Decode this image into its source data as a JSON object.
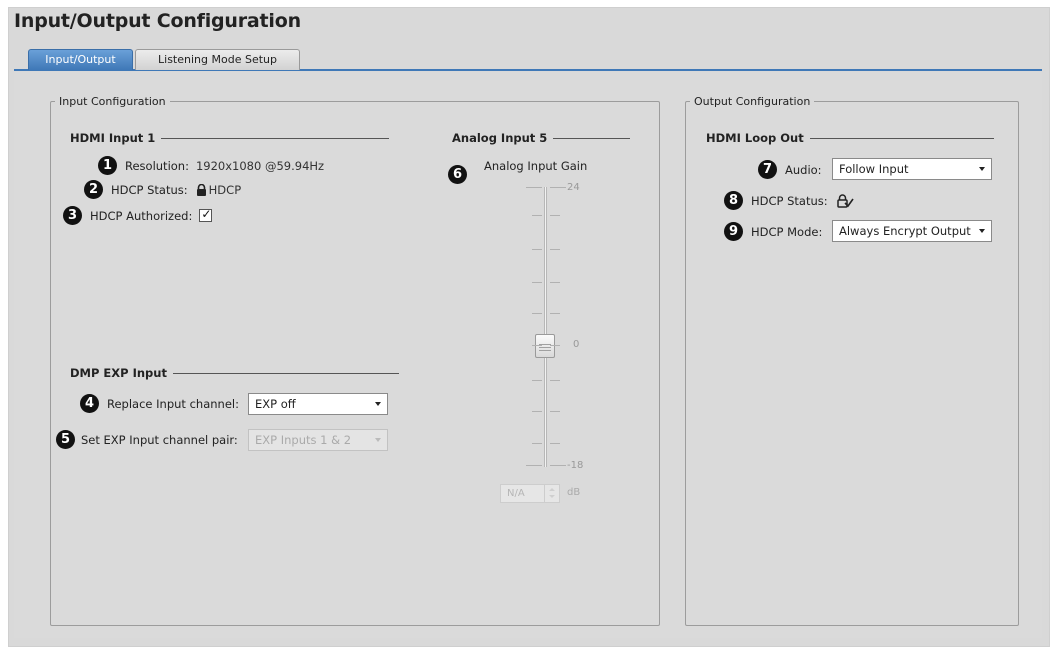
{
  "page": {
    "title": "Input/Output Configuration"
  },
  "tabs": [
    {
      "label": "Input/Output",
      "active": true
    },
    {
      "label": "Listening Mode Setup",
      "active": false
    }
  ],
  "input_config": {
    "legend": "Input Configuration",
    "hdmi_input": {
      "heading": "HDMI Input 1",
      "resolution_label": "Resolution:",
      "resolution_value": "1920x1080 @59.94Hz",
      "hdcp_status_label": "HDCP Status:",
      "hdcp_status_value": "HDCP",
      "hdcp_authorized_label": "HDCP Authorized:",
      "hdcp_authorized_checked": true
    },
    "dmp_exp": {
      "heading": "DMP EXP Input",
      "replace_label": "Replace Input channel:",
      "replace_value": "EXP off",
      "set_pair_label": "Set EXP Input channel pair:",
      "set_pair_value": "EXP Inputs 1 & 2"
    },
    "analog": {
      "heading": "Analog Input 5",
      "gain_label": "Analog Input Gain",
      "max_label": "24",
      "mid_label": "0",
      "min_label": "-18",
      "gain_value": "N/A",
      "unit": "dB",
      "range": [
        -18,
        24
      ],
      "level": 0
    }
  },
  "output_config": {
    "legend": "Output Configuration",
    "hdmi_loop": {
      "heading": "HDMI Loop Out",
      "audio_label": "Audio:",
      "audio_value": "Follow Input",
      "hdcp_status_label": "HDCP Status:",
      "hdcp_mode_label": "HDCP Mode:",
      "hdcp_mode_value": "Always Encrypt Output"
    }
  },
  "badges": [
    "1",
    "2",
    "3",
    "4",
    "5",
    "6",
    "7",
    "8",
    "9"
  ],
  "colors": {
    "accent": "#3f78b7",
    "panel_bg": "#dadada"
  },
  "icons": {
    "lock": "lock-icon",
    "hdcp_status_output": "lock-check-icon"
  }
}
